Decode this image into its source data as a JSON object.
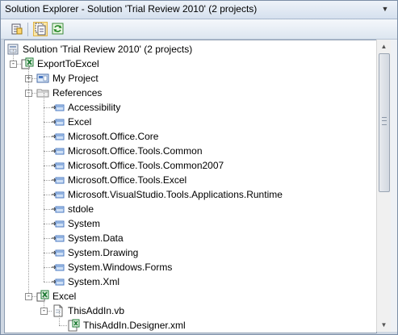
{
  "window": {
    "title": "Solution Explorer - Solution 'Trial Review 2010' (2 projects)",
    "dropdown_glyph": "▼"
  },
  "toolbar": {
    "buttons": [
      {
        "name": "properties-button",
        "icon": "properties-icon"
      },
      {
        "name": "show-all-files-button",
        "icon": "show-all-files-icon",
        "active": true
      },
      {
        "name": "refresh-button",
        "icon": "refresh-icon"
      }
    ]
  },
  "tree": {
    "nodes": [
      {
        "label": "Solution 'Trial Review 2010' (2 projects)",
        "level": 0,
        "icon": "solution-icon",
        "expander": "none"
      },
      {
        "label": "ExportToExcel",
        "level": 1,
        "icon": "vb-project-icon",
        "expander": "minus"
      },
      {
        "label": "My Project",
        "level": 2,
        "icon": "my-project-icon",
        "expander": "plus"
      },
      {
        "label": "References",
        "level": 2,
        "icon": "references-folder-icon",
        "expander": "minus"
      },
      {
        "label": "Accessibility",
        "level": 3,
        "icon": "reference-icon",
        "expander": "none"
      },
      {
        "label": "Excel",
        "level": 3,
        "icon": "reference-icon",
        "expander": "none"
      },
      {
        "label": "Microsoft.Office.Core",
        "level": 3,
        "icon": "reference-icon",
        "expander": "none"
      },
      {
        "label": "Microsoft.Office.Tools.Common",
        "level": 3,
        "icon": "reference-icon",
        "expander": "none"
      },
      {
        "label": "Microsoft.Office.Tools.Common2007",
        "level": 3,
        "icon": "reference-icon",
        "expander": "none"
      },
      {
        "label": "Microsoft.Office.Tools.Excel",
        "level": 3,
        "icon": "reference-icon",
        "expander": "none"
      },
      {
        "label": "Microsoft.VisualStudio.Tools.Applications.Runtime",
        "level": 3,
        "icon": "reference-icon",
        "expander": "none"
      },
      {
        "label": "stdole",
        "level": 3,
        "icon": "reference-icon",
        "expander": "none"
      },
      {
        "label": "System",
        "level": 3,
        "icon": "reference-icon",
        "expander": "none"
      },
      {
        "label": "System.Data",
        "level": 3,
        "icon": "reference-icon",
        "expander": "none"
      },
      {
        "label": "System.Drawing",
        "level": 3,
        "icon": "reference-icon",
        "expander": "none"
      },
      {
        "label": "System.Windows.Forms",
        "level": 3,
        "icon": "reference-icon",
        "expander": "none"
      },
      {
        "label": "System.Xml",
        "level": 3,
        "icon": "reference-icon",
        "expander": "none"
      },
      {
        "label": "Excel",
        "level": 2,
        "icon": "excel-folder-icon",
        "expander": "minus"
      },
      {
        "label": "ThisAddIn.vb",
        "level": 3,
        "icon": "vb-file-icon",
        "expander": "minus"
      },
      {
        "label": "ThisAddIn.Designer.xml",
        "level": 4,
        "icon": "designer-xml-icon",
        "expander": "none"
      }
    ]
  },
  "scrollbar": {
    "up_glyph": "▲",
    "down_glyph": "▼"
  },
  "colors": {
    "title_bg": "#dbe4f0",
    "tree_bg": "#ffffff",
    "expander_border": "#8c8c8c",
    "excel_green": "#1e7b34",
    "reference_blue": "#4a78c2"
  }
}
